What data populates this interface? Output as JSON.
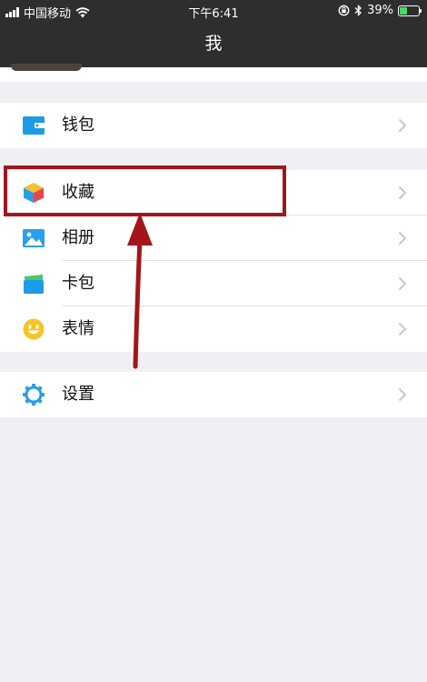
{
  "status_bar": {
    "carrier": "中国移动",
    "time": "下午6:41",
    "battery_percent": "39%",
    "battery_level": 0.39
  },
  "nav": {
    "title": "我"
  },
  "groups": [
    {
      "items": [
        {
          "label": "钱包",
          "icon": "wallet-icon"
        }
      ]
    },
    {
      "items": [
        {
          "label": "收藏",
          "icon": "favorites-cube-icon"
        },
        {
          "label": "相册",
          "icon": "album-icon"
        },
        {
          "label": "卡包",
          "icon": "card-package-icon"
        },
        {
          "label": "表情",
          "icon": "emoji-smile-icon"
        }
      ]
    },
    {
      "items": [
        {
          "label": "设置",
          "icon": "settings-gear-icon"
        }
      ]
    }
  ],
  "colors": {
    "header": "#2e2e30",
    "background": "#efeff4",
    "annotation": "#a3151b",
    "wallet_blue": "#1e9be8",
    "battery_green": "#4cd964"
  }
}
